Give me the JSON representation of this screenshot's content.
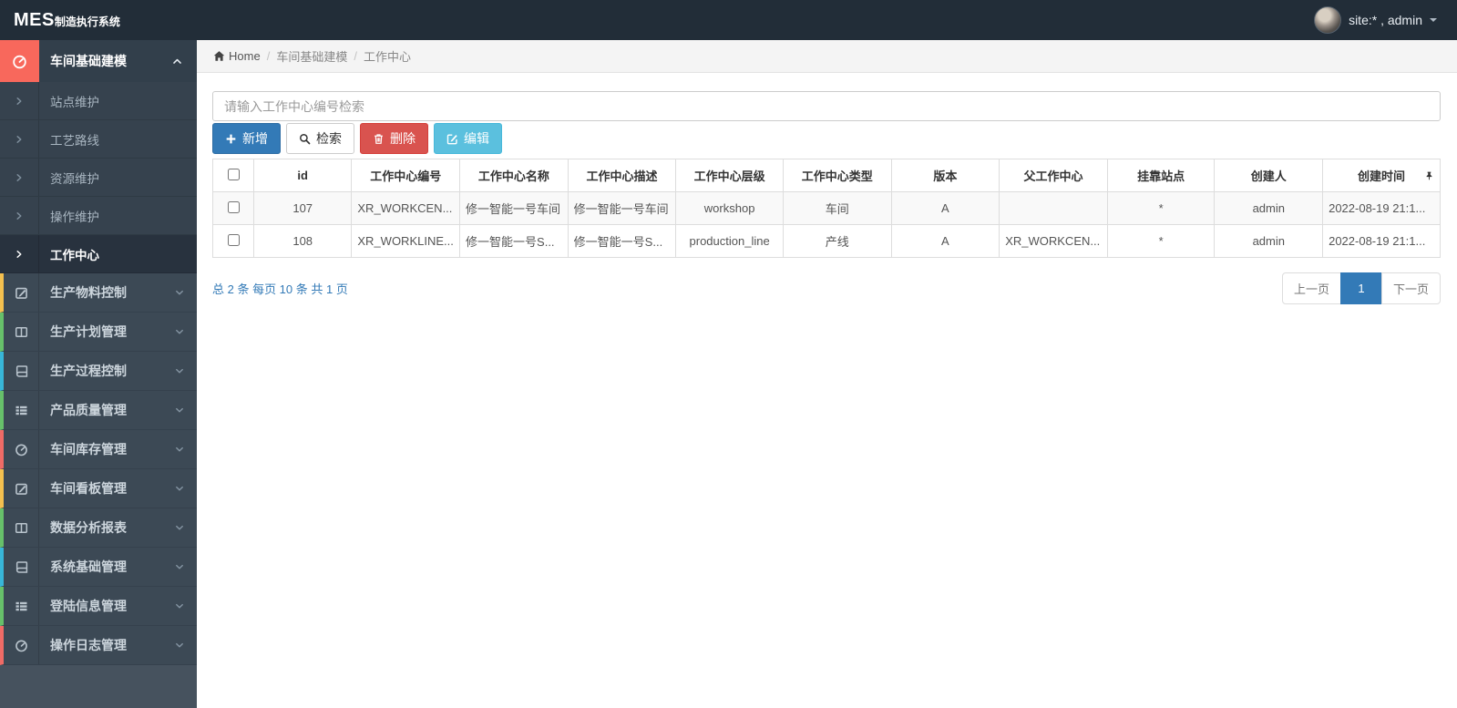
{
  "navbar": {
    "logo_bold": "MES",
    "logo_rest": "制造执行系统",
    "user_label": "site:* , admin"
  },
  "sidebar": {
    "group": {
      "label": "车间基础建模",
      "icon": "tachometer",
      "accent": "#f8685c"
    },
    "submenu": [
      {
        "label": "站点维护"
      },
      {
        "label": "工艺路线"
      },
      {
        "label": "资源维护"
      },
      {
        "label": "操作维护"
      },
      {
        "label": "工作中心",
        "active": true
      }
    ],
    "items": [
      {
        "label": "生产物料控制",
        "icon": "pencil-square",
        "accent": "#f4c04f"
      },
      {
        "label": "生产计划管理",
        "icon": "columns",
        "accent": "#67c06a"
      },
      {
        "label": "生产过程控制",
        "icon": "book",
        "accent": "#38b6d8"
      },
      {
        "label": "产品质量管理",
        "icon": "th-list",
        "accent": "#67c06a"
      },
      {
        "label": "车间库存管理",
        "icon": "tachometer",
        "accent": "#ef6b66"
      },
      {
        "label": "车间看板管理",
        "icon": "pencil-square",
        "accent": "#f4c04f"
      },
      {
        "label": "数据分析报表",
        "icon": "columns",
        "accent": "#67c06a"
      },
      {
        "label": "系统基础管理",
        "icon": "book",
        "accent": "#38b6d8"
      },
      {
        "label": "登陆信息管理",
        "icon": "th-list",
        "accent": "#67c06a"
      },
      {
        "label": "操作日志管理",
        "icon": "tachometer",
        "accent": "#ef6b66"
      }
    ]
  },
  "breadcrumb": {
    "home": "Home",
    "section": "车间基础建模",
    "page": "工作中心"
  },
  "toolbar": {
    "search_placeholder": "请输入工作中心编号检索",
    "add_label": "新增",
    "search_label": "检索",
    "delete_label": "删除",
    "edit_label": "编辑"
  },
  "table": {
    "columns": [
      {
        "label": "id"
      },
      {
        "label": "工作中心编号"
      },
      {
        "label": "工作中心名称"
      },
      {
        "label": "工作中心描述"
      },
      {
        "label": "工作中心层级"
      },
      {
        "label": "工作中心类型"
      },
      {
        "label": "版本"
      },
      {
        "label": "父工作中心"
      },
      {
        "label": "挂靠站点"
      },
      {
        "label": "创建人"
      },
      {
        "label": "创建时间",
        "icon": "pin"
      }
    ],
    "rows": [
      [
        "107",
        "XR_WORKCEN...",
        "修一智能一号车间",
        "修一智能一号车间",
        "workshop",
        "车间",
        "A",
        "",
        "*",
        "admin",
        "2022-08-19 21:1..."
      ],
      [
        "108",
        "XR_WORKLINE...",
        "修一智能一号S...",
        "修一智能一号S...",
        "production_line",
        "产线",
        "A",
        "XR_WORKCEN...",
        "*",
        "admin",
        "2022-08-19 21:1..."
      ]
    ]
  },
  "pagination": {
    "summary": "总 2 条 每页 10 条 共 1 页",
    "prev": "上一页",
    "current": "1",
    "next": "下一页"
  },
  "colors": {
    "primary": "#337ab7",
    "danger": "#d9534f",
    "info": "#5bc0de",
    "accent_red": "#f8685c",
    "accent_yellow": "#f4c04f",
    "accent_green": "#67c06a",
    "accent_teal": "#38b6d8",
    "navbar_bg": "#222d38"
  }
}
